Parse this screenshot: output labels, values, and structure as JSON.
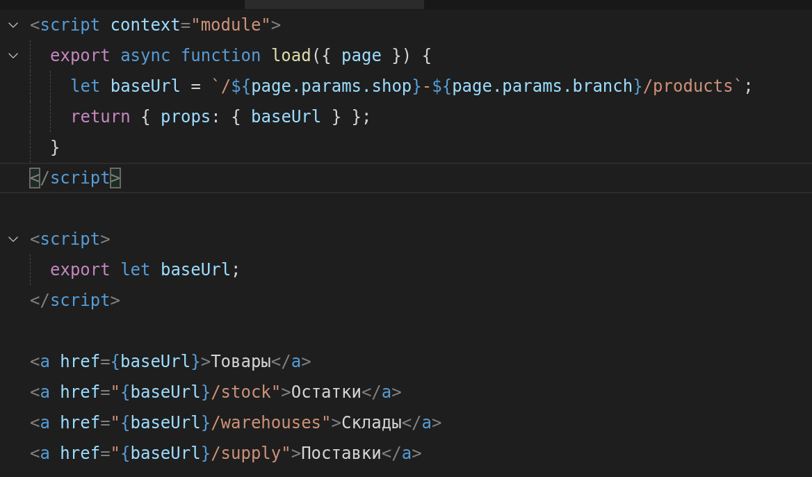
{
  "editor": {
    "lines": [
      {
        "kind": "code",
        "current": false,
        "expanded": true,
        "tokens": [
          {
            "kind": "punct",
            "text": "<"
          },
          {
            "kind": "tag",
            "text": "script "
          },
          {
            "kind": "attr",
            "text": "context"
          },
          {
            "kind": "punct",
            "text": "="
          },
          {
            "kind": "string",
            "text": "\"module\""
          },
          {
            "kind": "punct",
            "text": ">"
          }
        ],
        "children": [
          {
            "kind": "code",
            "current": false,
            "expanded": true,
            "tokens": [
              {
                "kind": "control",
                "text": "export "
              },
              {
                "kind": "keyword",
                "text": "async function "
              },
              {
                "kind": "function",
                "text": "load"
              },
              {
                "kind": "text",
                "text": "({ "
              },
              {
                "kind": "variable",
                "text": "page"
              },
              {
                "kind": "text",
                "text": " }) {"
              }
            ],
            "children": [
              {
                "kind": "code",
                "current": false,
                "tokens": [
                  {
                    "kind": "keyword",
                    "text": "let "
                  },
                  {
                    "kind": "variable",
                    "text": "baseUrl"
                  },
                  {
                    "kind": "text",
                    "text": " = "
                  },
                  {
                    "kind": "string",
                    "text": "`/"
                  },
                  {
                    "kind": "keyword",
                    "text": "${"
                  },
                  {
                    "kind": "variable",
                    "text": "page.params.shop"
                  },
                  {
                    "kind": "keyword",
                    "text": "}"
                  },
                  {
                    "kind": "string",
                    "text": "-"
                  },
                  {
                    "kind": "keyword",
                    "text": "${"
                  },
                  {
                    "kind": "variable",
                    "text": "page.params.branch"
                  },
                  {
                    "kind": "keyword",
                    "text": "}"
                  },
                  {
                    "kind": "string",
                    "text": "/products`"
                  },
                  {
                    "kind": "text",
                    "text": ";"
                  }
                ]
              },
              {
                "kind": "code",
                "current": false,
                "tokens": [
                  {
                    "kind": "control",
                    "text": "return"
                  },
                  {
                    "kind": "text",
                    "text": " { "
                  },
                  {
                    "kind": "variable",
                    "text": "props"
                  },
                  {
                    "kind": "text",
                    "text": ": { "
                  },
                  {
                    "kind": "variable",
                    "text": "baseUrl"
                  },
                  {
                    "kind": "text",
                    "text": " } };"
                  }
                ]
              }
            ]
          },
          {
            "kind": "code",
            "current": false,
            "tokens": [
              {
                "kind": "text",
                "text": "}"
              }
            ]
          }
        ]
      },
      {
        "kind": "code",
        "current": true,
        "tokens": [
          {
            "kind": "match",
            "text": "<"
          },
          {
            "kind": "punct",
            "text": "/"
          },
          {
            "kind": "tag",
            "text": "script"
          },
          {
            "kind": "match",
            "text": ">"
          }
        ]
      },
      {
        "kind": "blank",
        "current": false
      },
      {
        "kind": "code",
        "current": false,
        "expanded": true,
        "tokens": [
          {
            "kind": "punct",
            "text": "<"
          },
          {
            "kind": "tag",
            "text": "script"
          },
          {
            "kind": "punct",
            "text": ">"
          }
        ],
        "children": [
          {
            "kind": "code",
            "current": false,
            "tokens": [
              {
                "kind": "control",
                "text": "export "
              },
              {
                "kind": "keyword",
                "text": "let "
              },
              {
                "kind": "variable",
                "text": "baseUrl"
              },
              {
                "kind": "text",
                "text": ";"
              }
            ]
          }
        ]
      },
      {
        "kind": "code",
        "current": false,
        "tokens": [
          {
            "kind": "punct",
            "text": "</"
          },
          {
            "kind": "tag",
            "text": "script"
          },
          {
            "kind": "punct",
            "text": ">"
          }
        ]
      },
      {
        "kind": "blank",
        "current": false
      },
      {
        "kind": "code",
        "current": false,
        "tokens": [
          {
            "kind": "punct",
            "text": "<"
          },
          {
            "kind": "tag",
            "text": "a "
          },
          {
            "kind": "attr",
            "text": "href"
          },
          {
            "kind": "punct",
            "text": "="
          },
          {
            "kind": "keyword",
            "text": "{"
          },
          {
            "kind": "variable",
            "text": "baseUrl"
          },
          {
            "kind": "keyword",
            "text": "}"
          },
          {
            "kind": "punct",
            "text": ">"
          },
          {
            "kind": "text",
            "text": "Товары"
          },
          {
            "kind": "punct",
            "text": "</"
          },
          {
            "kind": "tag",
            "text": "a"
          },
          {
            "kind": "punct",
            "text": ">"
          }
        ]
      },
      {
        "kind": "code",
        "current": false,
        "tokens": [
          {
            "kind": "punct",
            "text": "<"
          },
          {
            "kind": "tag",
            "text": "a "
          },
          {
            "kind": "attr",
            "text": "href"
          },
          {
            "kind": "punct",
            "text": "="
          },
          {
            "kind": "string",
            "text": "\""
          },
          {
            "kind": "keyword",
            "text": "{"
          },
          {
            "kind": "variable",
            "text": "baseUrl"
          },
          {
            "kind": "keyword",
            "text": "}"
          },
          {
            "kind": "string",
            "text": "/stock\""
          },
          {
            "kind": "punct",
            "text": ">"
          },
          {
            "kind": "text",
            "text": "Остатки"
          },
          {
            "kind": "punct",
            "text": "</"
          },
          {
            "kind": "tag",
            "text": "a"
          },
          {
            "kind": "punct",
            "text": ">"
          }
        ]
      },
      {
        "kind": "code",
        "current": false,
        "tokens": [
          {
            "kind": "punct",
            "text": "<"
          },
          {
            "kind": "tag",
            "text": "a "
          },
          {
            "kind": "attr",
            "text": "href"
          },
          {
            "kind": "punct",
            "text": "="
          },
          {
            "kind": "string",
            "text": "\""
          },
          {
            "kind": "keyword",
            "text": "{"
          },
          {
            "kind": "variable",
            "text": "baseUrl"
          },
          {
            "kind": "keyword",
            "text": "}"
          },
          {
            "kind": "string",
            "text": "/warehouses\""
          },
          {
            "kind": "punct",
            "text": ">"
          },
          {
            "kind": "text",
            "text": "Склады"
          },
          {
            "kind": "punct",
            "text": "</"
          },
          {
            "kind": "tag",
            "text": "a"
          },
          {
            "kind": "punct",
            "text": ">"
          }
        ]
      },
      {
        "kind": "code",
        "current": false,
        "tokens": [
          {
            "kind": "punct",
            "text": "<"
          },
          {
            "kind": "tag",
            "text": "a "
          },
          {
            "kind": "attr",
            "text": "href"
          },
          {
            "kind": "punct",
            "text": "="
          },
          {
            "kind": "string",
            "text": "\""
          },
          {
            "kind": "keyword",
            "text": "{"
          },
          {
            "kind": "variable",
            "text": "baseUrl"
          },
          {
            "kind": "keyword",
            "text": "}"
          },
          {
            "kind": "string",
            "text": "/supply\""
          },
          {
            "kind": "punct",
            "text": ">"
          },
          {
            "kind": "text",
            "text": "Поставки"
          },
          {
            "kind": "punct",
            "text": "</"
          },
          {
            "kind": "tag",
            "text": "a"
          },
          {
            "kind": "punct",
            "text": ">"
          }
        ]
      }
    ]
  }
}
